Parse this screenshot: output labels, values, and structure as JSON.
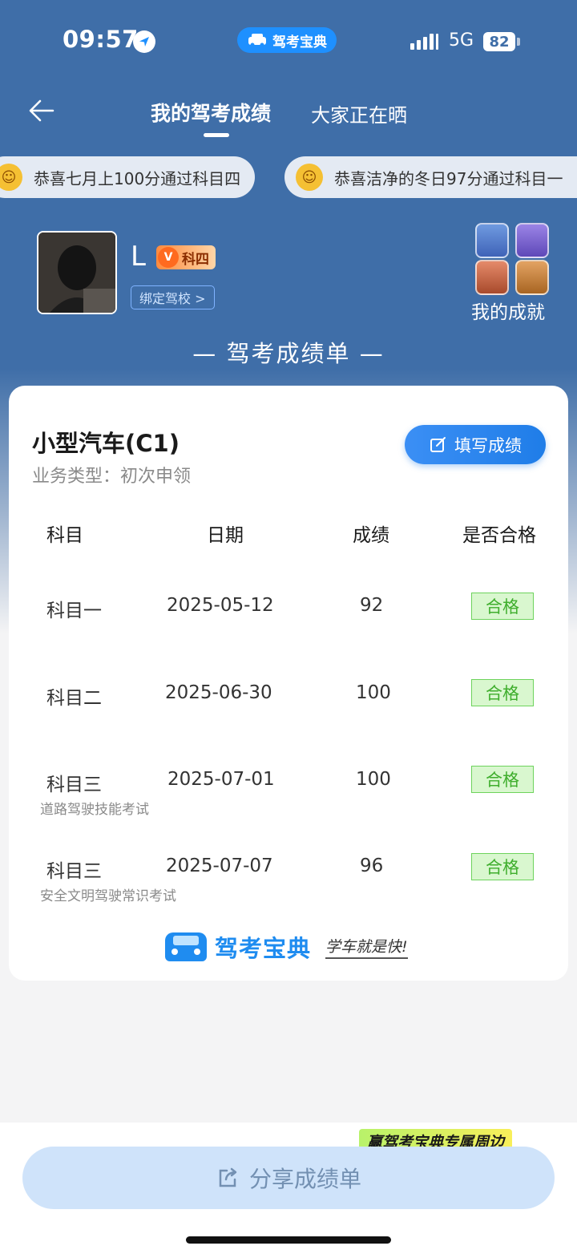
{
  "status_bar": {
    "time": "09:57",
    "network": "5G",
    "battery": "82",
    "app_pill": "驾考宝典"
  },
  "nav": {
    "tab_active": "我的驾考成绩",
    "tab_other": "大家正在晒"
  },
  "ticker": [
    {
      "text": "恭喜七月上100分通过科目四"
    },
    {
      "text": "恭喜洁净的冬日97分通过科目一"
    }
  ],
  "profile": {
    "username": "L",
    "level_badge": "科四",
    "bind_school": "绑定驾校 >",
    "achievements_label": "我的成就"
  },
  "section_title": "— 驾考成绩单 —",
  "card": {
    "car_type": "小型汽车(C1)",
    "business_type": "业务类型：初次申领",
    "fill_button": "填写成绩",
    "headers": {
      "subject": "科目",
      "date": "日期",
      "score": "成绩",
      "passed": "是否合格"
    },
    "rows": [
      {
        "subject": "科目一",
        "date": "2025-05-12",
        "score": "92",
        "status": "合格",
        "note": ""
      },
      {
        "subject": "科目二",
        "date": "2025-06-30",
        "score": "100",
        "status": "合格",
        "note": ""
      },
      {
        "subject": "科目三",
        "date": "2025-07-01",
        "score": "100",
        "status": "合格",
        "note": "道路驾驶技能考试"
      },
      {
        "subject": "科目三",
        "date": "2025-07-07",
        "score": "96",
        "status": "合格",
        "note": "安全文明驾驶常识考试"
      }
    ],
    "brand_name": "驾考宝典",
    "brand_slogan": "学车就是快!"
  },
  "promo": "赢驾考宝典专属周边",
  "share_button": "分享成绩单",
  "colors": {
    "header_bg": "#3f6ea8",
    "accent": "#1f8cf0",
    "pass_green": "#3fae2d"
  }
}
